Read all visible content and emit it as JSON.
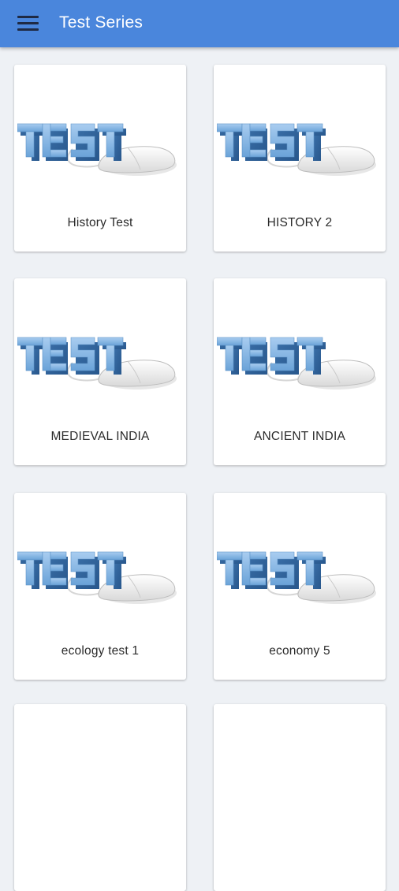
{
  "app_bar": {
    "title": "Test Series",
    "menu_icon": "hamburger-menu-icon",
    "background_color": "#4a86dc"
  },
  "thumbnail": {
    "word": "TEST",
    "icon": "test-mouse-icon"
  },
  "cards": [
    {
      "label": "History Test"
    },
    {
      "label": "HISTORY 2"
    },
    {
      "label": "MEDIEVAL INDIA"
    },
    {
      "label": "ANCIENT INDIA"
    },
    {
      "label": "ecology test 1"
    },
    {
      "label": "economy 5"
    }
  ]
}
